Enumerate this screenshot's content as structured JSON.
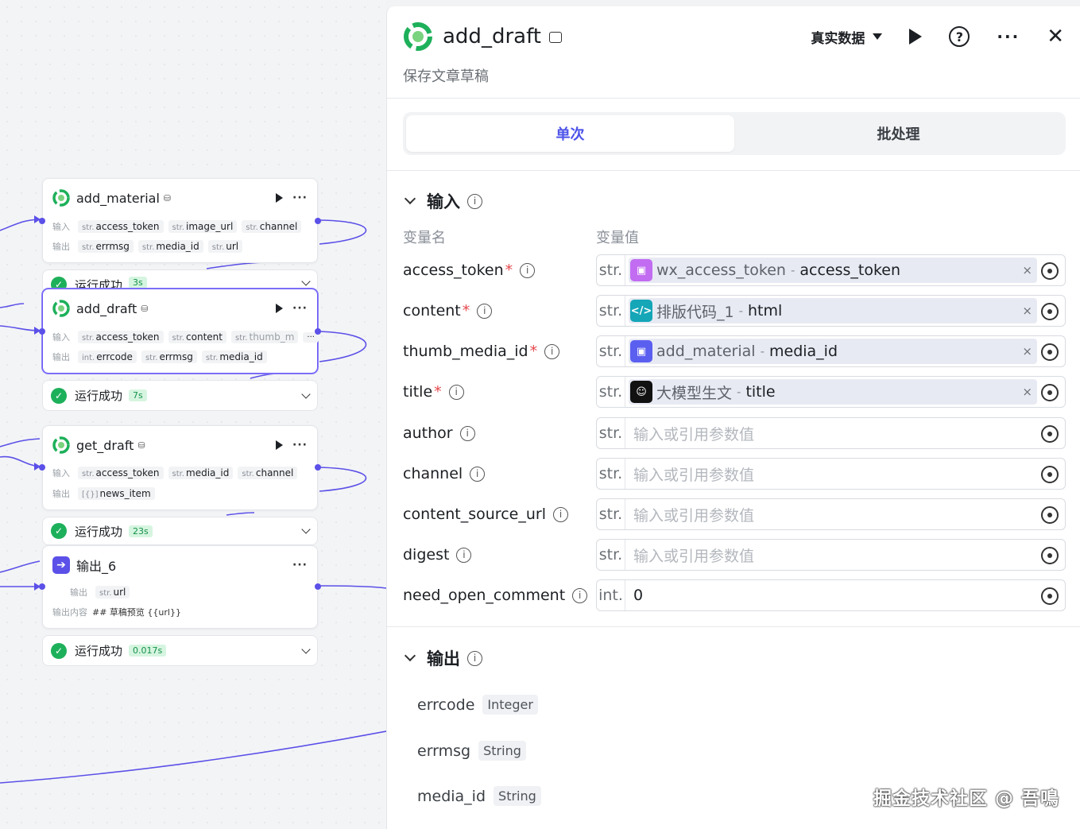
{
  "canvas": {
    "nodes": [
      {
        "title": "add_material",
        "inputs_label": "输入",
        "outputs_label": "输出",
        "inputs": [
          {
            "type": "str.",
            "name": "access_token"
          },
          {
            "type": "str.",
            "name": "image_url"
          },
          {
            "type": "str.",
            "name": "channel"
          }
        ],
        "outputs": [
          {
            "type": "str.",
            "name": "errmsg"
          },
          {
            "type": "str.",
            "name": "media_id"
          },
          {
            "type": "str.",
            "name": "url"
          }
        ],
        "status": "运行成功",
        "time": "3s"
      },
      {
        "title": "add_draft",
        "inputs_label": "输入",
        "outputs_label": "输出",
        "inputs": [
          {
            "type": "str.",
            "name": "access_token"
          },
          {
            "type": "str.",
            "name": "content"
          },
          {
            "type": "str.",
            "name": "thumb_m"
          }
        ],
        "more": "···",
        "outputs": [
          {
            "type": "int.",
            "name": "errcode"
          },
          {
            "type": "str.",
            "name": "errmsg"
          },
          {
            "type": "str.",
            "name": "media_id"
          }
        ],
        "status": "运行成功",
        "time": "7s"
      },
      {
        "title": "get_draft",
        "inputs_label": "输入",
        "outputs_label": "输出",
        "inputs": [
          {
            "type": "str.",
            "name": "access_token"
          },
          {
            "type": "str.",
            "name": "media_id"
          },
          {
            "type": "str.",
            "name": "channel"
          }
        ],
        "outputs": [
          {
            "type": "[{}]",
            "name": "news_item"
          }
        ],
        "status": "运行成功",
        "time": "23s"
      },
      {
        "title": "输出_6",
        "outputs_label": "输出",
        "outputs": [
          {
            "type": "str.",
            "name": "url"
          }
        ],
        "content_label": "输出内容",
        "content": "## 草稿预览 {{url}}",
        "status": "运行成功",
        "time": "0.017s"
      }
    ]
  },
  "panel": {
    "title": "add_draft",
    "description": "保存文章草稿",
    "data_mode": "真实数据",
    "tabs": [
      "单次",
      "批处理"
    ],
    "input_section": "输入",
    "col_name": "变量名",
    "col_value": "变量值",
    "inputs": [
      {
        "name": "access_token",
        "required": true,
        "type": "str.",
        "ref_node": "wx_access_token",
        "ref_var": "access_token",
        "icon": "cube-icon"
      },
      {
        "name": "content",
        "required": true,
        "type": "str.",
        "ref_node": "排版代码_1",
        "ref_var": "html",
        "icon": "code-icon"
      },
      {
        "name": "thumb_media_id",
        "required": true,
        "type": "str.",
        "ref_node": "add_material",
        "ref_var": "media_id",
        "icon": "cube-icon"
      },
      {
        "name": "title",
        "required": true,
        "type": "str.",
        "ref_node": "大模型生文",
        "ref_var": "title",
        "icon": "llm-icon"
      },
      {
        "name": "author",
        "required": false,
        "type": "str.",
        "placeholder": "输入或引用参数值"
      },
      {
        "name": "channel",
        "required": false,
        "type": "str.",
        "placeholder": "输入或引用参数值"
      },
      {
        "name": "content_source_url",
        "required": false,
        "type": "str.",
        "placeholder": "输入或引用参数值"
      },
      {
        "name": "digest",
        "required": false,
        "type": "str.",
        "placeholder": "输入或引用参数值"
      },
      {
        "name": "need_open_comment",
        "required": false,
        "type": "int.",
        "value": "0"
      }
    ],
    "output_section": "输出",
    "outputs": [
      {
        "name": "errcode",
        "type": "Integer"
      },
      {
        "name": "errmsg",
        "type": "String"
      },
      {
        "name": "media_id",
        "type": "String"
      }
    ],
    "required_mark": "*",
    "clear_icon": "×"
  },
  "watermark": "掘金技术社区 @ 吾鳴",
  "colors": {
    "accent": "#4d53e8",
    "port": "#5b50e8",
    "success": "#1db05a",
    "required": "#e5484d"
  }
}
